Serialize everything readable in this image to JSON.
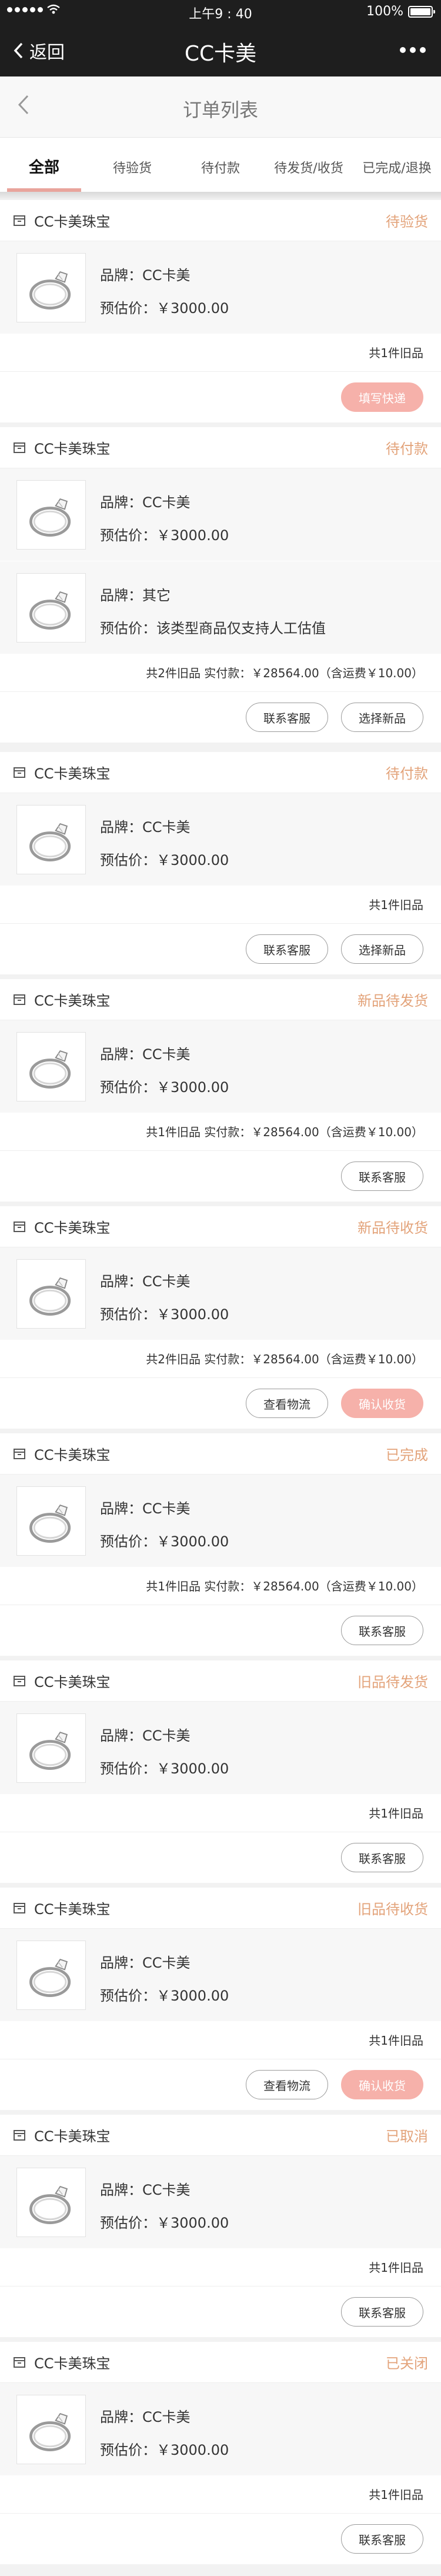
{
  "status_bar": {
    "time": "上午9 : 40",
    "battery": "100%"
  },
  "nav": {
    "back_label": "返回",
    "title": "CC卡美"
  },
  "page": {
    "title": "订单列表"
  },
  "tabs": [
    "全部",
    "待验货",
    "待付款",
    "待发货/收货",
    "已完成/退换"
  ],
  "orders": [
    {
      "shop": "CC卡美珠宝",
      "status": "待验货",
      "items": [
        {
          "brand": "品牌：CC卡美",
          "price": "预估价：￥3000.00"
        }
      ],
      "summary": "共1件旧品",
      "buttons": [
        {
          "label": "填写快递",
          "primary": true
        }
      ]
    },
    {
      "shop": "CC卡美珠宝",
      "status": "待付款",
      "items": [
        {
          "brand": "品牌：CC卡美",
          "price": "预估价：￥3000.00"
        },
        {
          "brand": "品牌：其它",
          "price": "预估价：该类型商品仅支持人工估值"
        }
      ],
      "summary": "共2件旧品 实付款：￥28564.00（含运费￥10.00）",
      "buttons": [
        {
          "label": "联系客服",
          "primary": false
        },
        {
          "label": "选择新品",
          "primary": false
        }
      ]
    },
    {
      "shop": "CC卡美珠宝",
      "status": "待付款",
      "items": [
        {
          "brand": "品牌：CC卡美",
          "price": "预估价：￥3000.00"
        }
      ],
      "summary": "共1件旧品",
      "buttons": [
        {
          "label": "联系客服",
          "primary": false
        },
        {
          "label": "选择新品",
          "primary": false
        }
      ]
    },
    {
      "shop": "CC卡美珠宝",
      "status": "新品待发货",
      "items": [
        {
          "brand": "品牌：CC卡美",
          "price": "预估价：￥3000.00"
        }
      ],
      "summary": "共1件旧品 实付款：￥28564.00（含运费￥10.00）",
      "buttons": [
        {
          "label": "联系客服",
          "primary": false
        }
      ]
    },
    {
      "shop": "CC卡美珠宝",
      "status": "新品待收货",
      "items": [
        {
          "brand": "品牌：CC卡美",
          "price": "预估价：￥3000.00"
        }
      ],
      "summary": "共2件旧品 实付款：￥28564.00（含运费￥10.00）",
      "buttons": [
        {
          "label": "查看物流",
          "primary": false
        },
        {
          "label": "确认收货",
          "primary": true
        }
      ]
    },
    {
      "shop": "CC卡美珠宝",
      "status": "已完成",
      "items": [
        {
          "brand": "品牌：CC卡美",
          "price": "预估价：￥3000.00"
        }
      ],
      "summary": "共1件旧品 实付款：￥28564.00（含运费￥10.00）",
      "buttons": [
        {
          "label": "联系客服",
          "primary": false
        }
      ]
    },
    {
      "shop": "CC卡美珠宝",
      "status": "旧品待发货",
      "items": [
        {
          "brand": "品牌：CC卡美",
          "price": "预估价：￥3000.00"
        }
      ],
      "summary": "共1件旧品",
      "buttons": [
        {
          "label": "联系客服",
          "primary": false
        }
      ]
    },
    {
      "shop": "CC卡美珠宝",
      "status": "旧品待收货",
      "items": [
        {
          "brand": "品牌：CC卡美",
          "price": "预估价：￥3000.00"
        }
      ],
      "summary": "共1件旧品",
      "buttons": [
        {
          "label": "查看物流",
          "primary": false
        },
        {
          "label": "确认收货",
          "primary": true
        }
      ]
    },
    {
      "shop": "CC卡美珠宝",
      "status": "已取消",
      "items": [
        {
          "brand": "品牌：CC卡美",
          "price": "预估价：￥3000.00"
        }
      ],
      "summary": "共1件旧品",
      "buttons": [
        {
          "label": "联系客服",
          "primary": false
        }
      ]
    },
    {
      "shop": "CC卡美珠宝",
      "status": "已关闭",
      "items": [
        {
          "brand": "品牌：CC卡美",
          "price": "预估价：￥3000.00"
        }
      ],
      "summary": "共1件旧品",
      "buttons": [
        {
          "label": "联系客服",
          "primary": false
        }
      ]
    }
  ]
}
